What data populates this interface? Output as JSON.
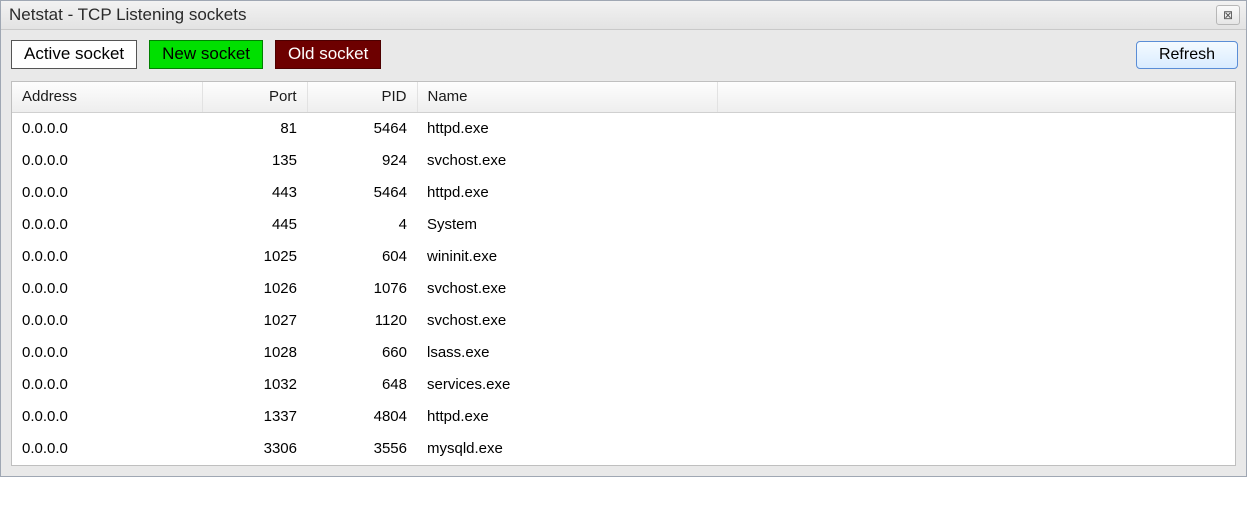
{
  "title": "Netstat - TCP Listening sockets",
  "close_glyph": "⊠",
  "legend": {
    "active": "Active socket",
    "new": "New socket",
    "old": "Old socket"
  },
  "buttons": {
    "refresh": "Refresh"
  },
  "columns": {
    "address": "Address",
    "port": "Port",
    "pid": "PID",
    "name": "Name",
    "extra": ""
  },
  "rows": [
    {
      "address": "0.0.0.0",
      "port": "81",
      "pid": "5464",
      "name": "httpd.exe"
    },
    {
      "address": "0.0.0.0",
      "port": "135",
      "pid": "924",
      "name": "svchost.exe"
    },
    {
      "address": "0.0.0.0",
      "port": "443",
      "pid": "5464",
      "name": "httpd.exe"
    },
    {
      "address": "0.0.0.0",
      "port": "445",
      "pid": "4",
      "name": "System"
    },
    {
      "address": "0.0.0.0",
      "port": "1025",
      "pid": "604",
      "name": "wininit.exe"
    },
    {
      "address": "0.0.0.0",
      "port": "1026",
      "pid": "1076",
      "name": "svchost.exe"
    },
    {
      "address": "0.0.0.0",
      "port": "1027",
      "pid": "1120",
      "name": "svchost.exe"
    },
    {
      "address": "0.0.0.0",
      "port": "1028",
      "pid": "660",
      "name": "lsass.exe"
    },
    {
      "address": "0.0.0.0",
      "port": "1032",
      "pid": "648",
      "name": "services.exe"
    },
    {
      "address": "0.0.0.0",
      "port": "1337",
      "pid": "4804",
      "name": "httpd.exe"
    },
    {
      "address": "0.0.0.0",
      "port": "3306",
      "pid": "3556",
      "name": "mysqld.exe"
    }
  ]
}
